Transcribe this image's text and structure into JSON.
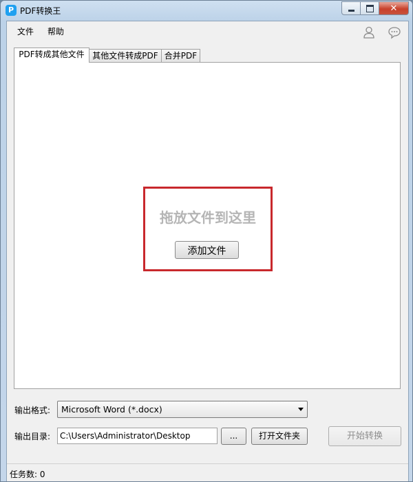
{
  "window": {
    "title": "PDF转换王",
    "app_icon_glyph": "P"
  },
  "menu": {
    "items": [
      "文件",
      "帮助"
    ]
  },
  "tabs": [
    {
      "label": "PDF转成其他文件",
      "active": true
    },
    {
      "label": "其他文件转成PDF",
      "active": false
    },
    {
      "label": "合并PDF",
      "active": false
    }
  ],
  "dropzone": {
    "hint": "拖放文件到这里",
    "add_button": "添加文件"
  },
  "output": {
    "format_label": "输出格式:",
    "format_value": "Microsoft Word (*.docx)",
    "dir_label": "输出目录:",
    "dir_value": "C:\\Users\\Administrator\\Desktop",
    "browse_button": "...",
    "open_folder_button": "打开文件夹",
    "start_button": "开始转换"
  },
  "status": {
    "tasks": "任务数: 0"
  },
  "colors": {
    "highlight_border": "#c8282c",
    "hint_text": "#b5b5b5",
    "app_icon": "#1fa0f0"
  }
}
